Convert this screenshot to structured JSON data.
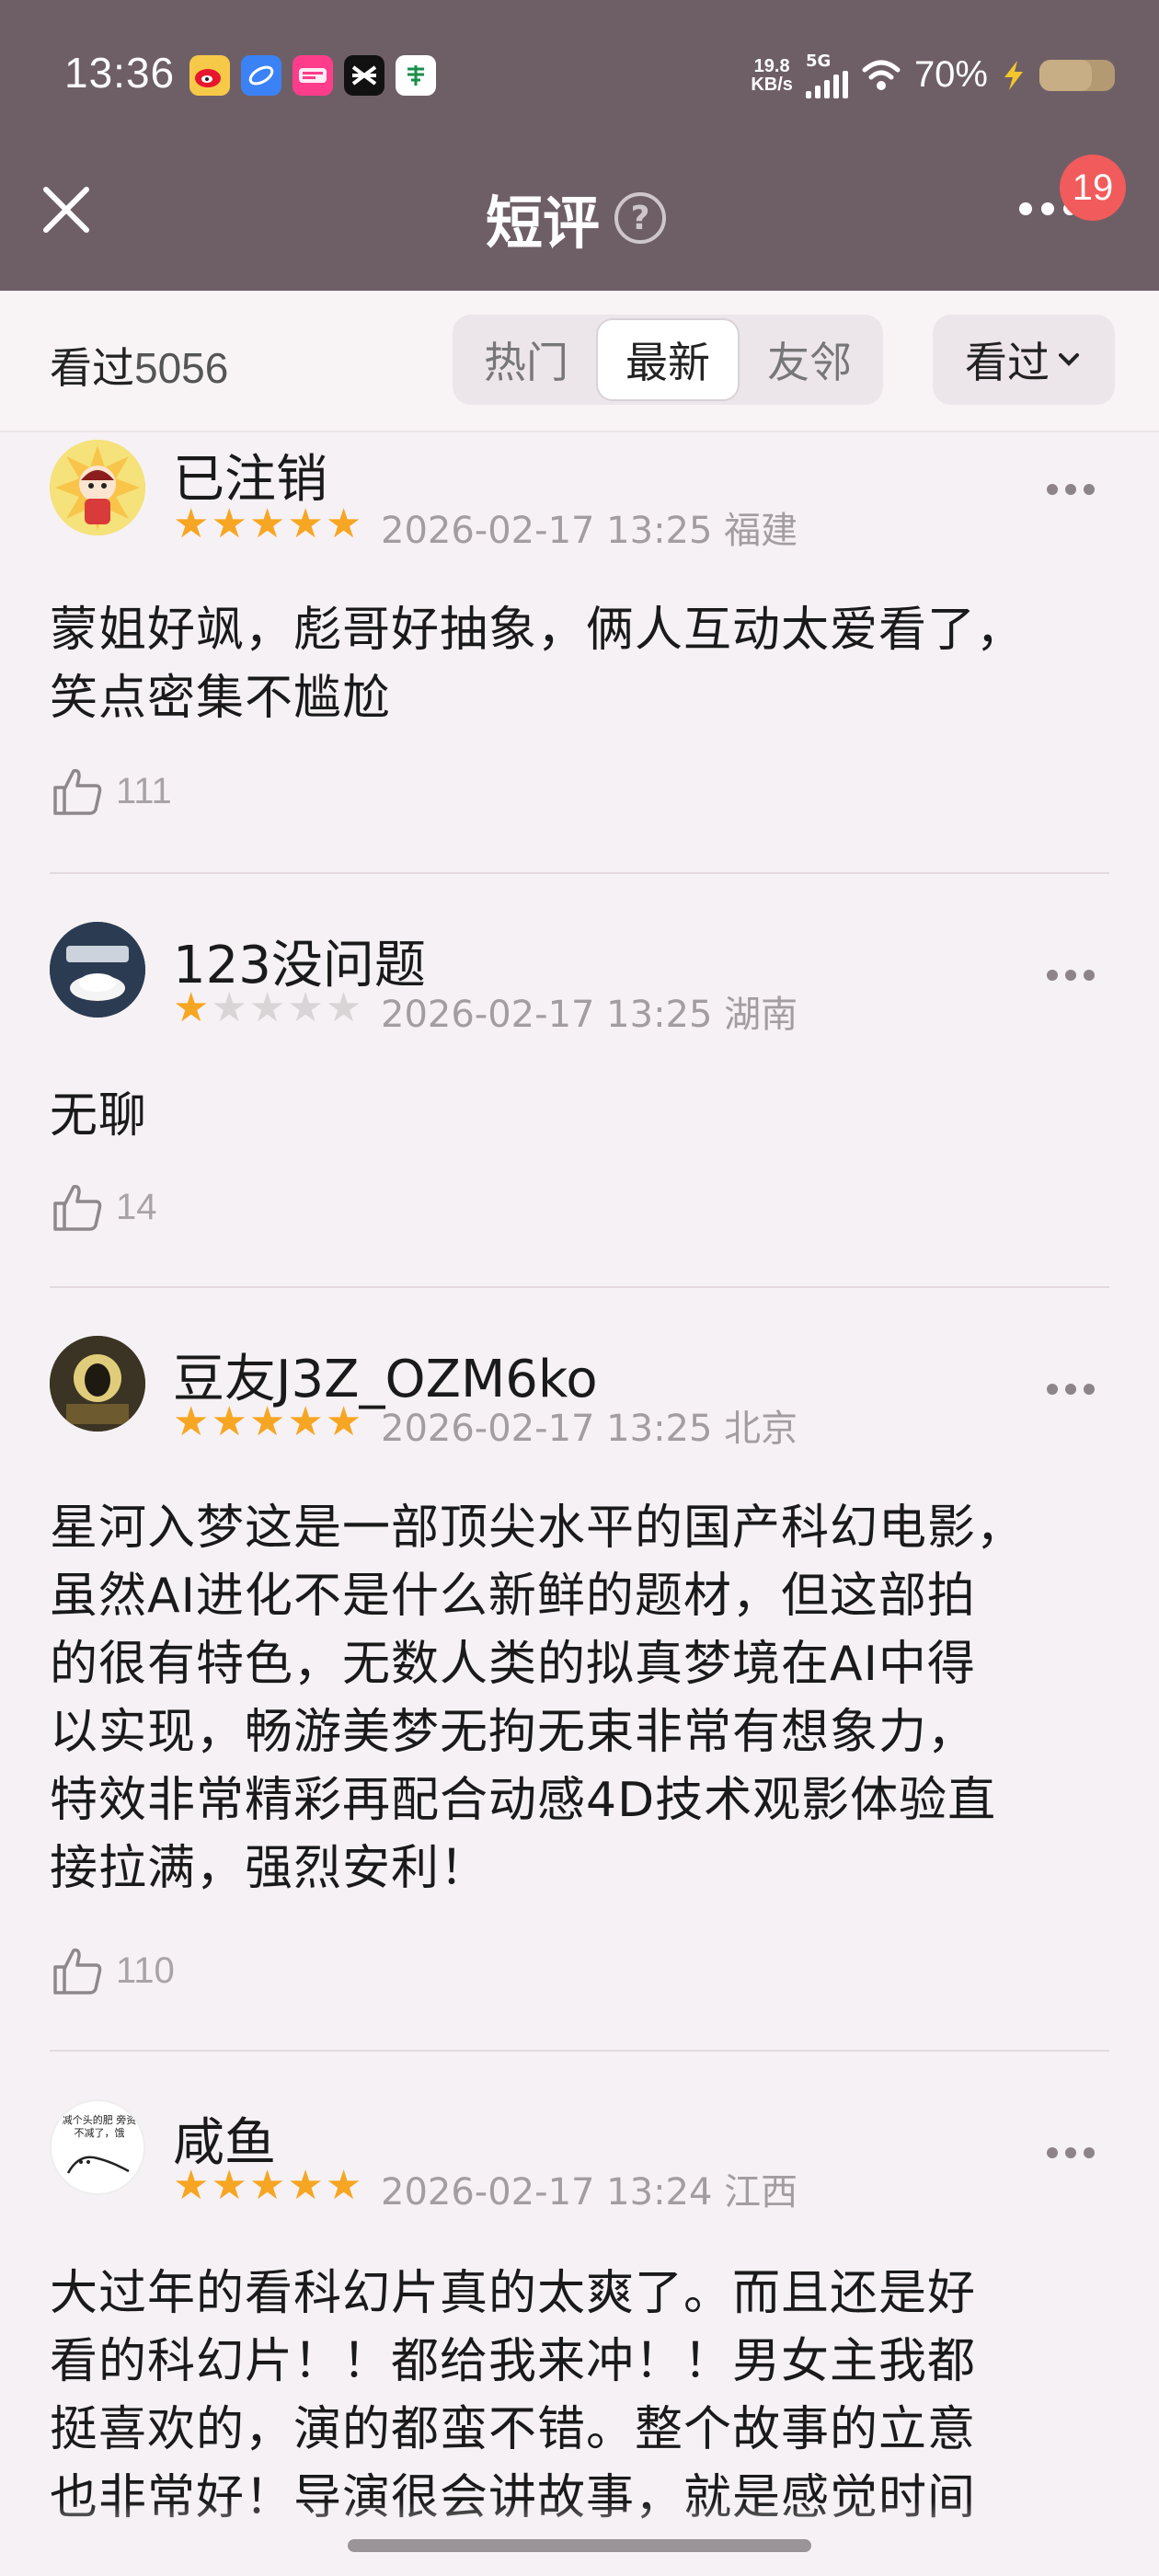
{
  "status_bar": {
    "time": "13:36",
    "net_speed_value": "19.8",
    "net_speed_unit": "KB/s",
    "network": "5G",
    "battery": "70%",
    "apps": [
      "weibo-icon",
      "browser-icon",
      "shop-icon",
      "capcut-icon",
      "post-icon"
    ]
  },
  "header": {
    "title": "短评",
    "help_icon": "question-circle-icon",
    "badge_count": "19"
  },
  "filter": {
    "seen_label": "看过",
    "seen_count": "5056",
    "tabs": [
      {
        "label": "热门",
        "active": false
      },
      {
        "label": "最新",
        "active": true
      },
      {
        "label": "友邻",
        "active": false
      }
    ],
    "dropdown_label": "看过"
  },
  "reviews": [
    {
      "username": "已注销",
      "stars": 5,
      "date": "2026-02-17 13:25",
      "location": "福建",
      "lines": [
        "蒙姐好飒，彪哥好抽象，俩人互动太爱看了，",
        "笑点密集不尴尬"
      ],
      "likes": "111"
    },
    {
      "username": "123没问题",
      "stars": 1,
      "date": "2026-02-17 13:25",
      "location": "湖南",
      "lines": [
        "无聊"
      ],
      "likes": "14"
    },
    {
      "username": "豆友J3Z_OZM6ko",
      "stars": 5,
      "date": "2026-02-17 13:25",
      "location": "北京",
      "lines": [
        "星河入梦这是一部顶尖水平的国产科幻电影，",
        "虽然AI进化不是什么新鲜的题材，但这部拍",
        "的很有特色，无数人类的拟真梦境在AI中得",
        "以实现，畅游美梦无拘无束非常有想象力，",
        "特效非常精彩再配合动感4D技术观影体验直",
        "接拉满，强烈安利！"
      ],
      "likes": "110"
    },
    {
      "username": "咸鱼",
      "stars": 5,
      "date": "2026-02-17 13:24",
      "location": "江西",
      "avatar_text": "减个头的肥 旁资不减了，饿",
      "lines": [
        "大过年的看科幻片真的太爽了。而且还是好",
        "看的科幻片！！都给我来冲！！男女主我都",
        "挺喜欢的，演的都蛮不错。整个故事的立意",
        "也非常好！导演很会讲故事，就是感觉时间"
      ],
      "likes": ""
    }
  ]
}
